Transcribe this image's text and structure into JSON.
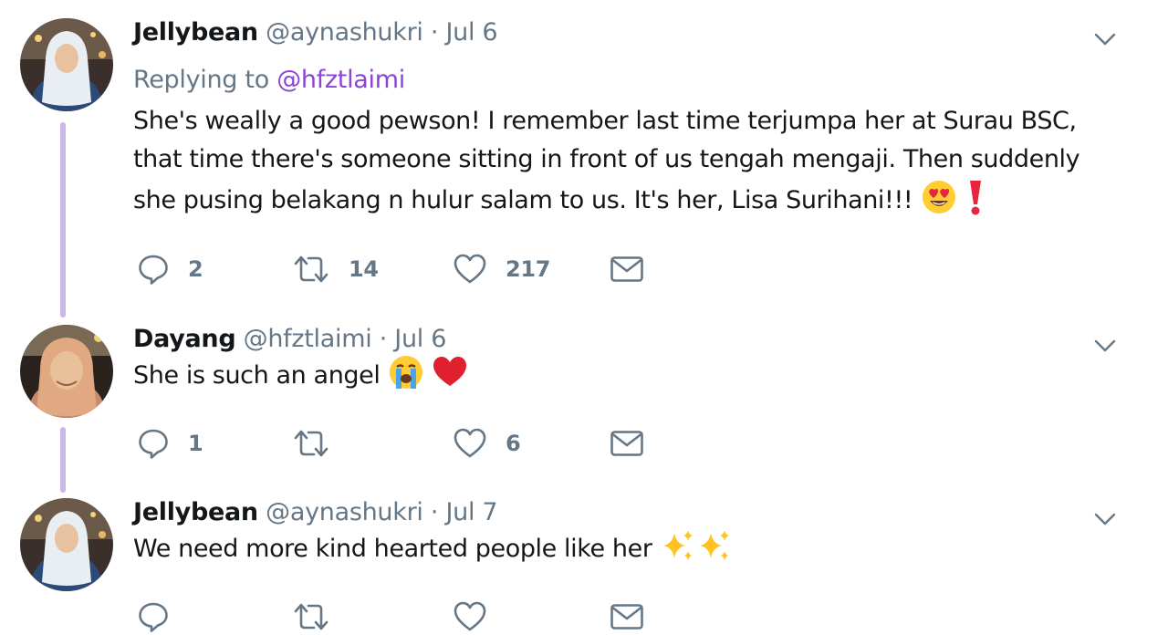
{
  "colors": {
    "accent_purple": "#8b45d6",
    "thread_line": "#ccb6ea",
    "secondary_text": "#657786",
    "primary_text": "#14171a"
  },
  "tweets": [
    {
      "name": "Jellybean",
      "handle": "@aynashukri",
      "separator": "·",
      "date": "Jul 6",
      "replying_prefix": "Replying to",
      "replying_to": "@hfztlaimi",
      "text": "She's weally a good pewson! I remember last time terjumpa her at Surau BSC, that time there's someone sitting in front of us tengah mengaji. Then suddenly she pusing belakang n hulur salam to us. It's her, Lisa Surihani!!!",
      "emojis": [
        "heart-eyes-emoji",
        "red-exclamation-emoji"
      ],
      "replies": "2",
      "retweets": "14",
      "likes": "217"
    },
    {
      "name": "Dayang",
      "handle": "@hfztlaimi",
      "separator": "·",
      "date": "Jul 6",
      "text": "She is such an angel",
      "emojis": [
        "loudly-crying-emoji",
        "red-heart-emoji"
      ],
      "replies": "1",
      "retweets": "",
      "likes": "6"
    },
    {
      "name": "Jellybean",
      "handle": "@aynashukri",
      "separator": "·",
      "date": "Jul 7",
      "text": "We need more kind hearted people like her",
      "emojis": [
        "sparkles-emoji",
        "sparkles-emoji"
      ],
      "replies": "",
      "retweets": "",
      "likes": ""
    }
  ],
  "icons": {
    "reply": "reply-icon",
    "retweet": "retweet-icon",
    "like": "heart-icon",
    "dm": "envelope-icon",
    "more": "chevron-down-icon"
  }
}
